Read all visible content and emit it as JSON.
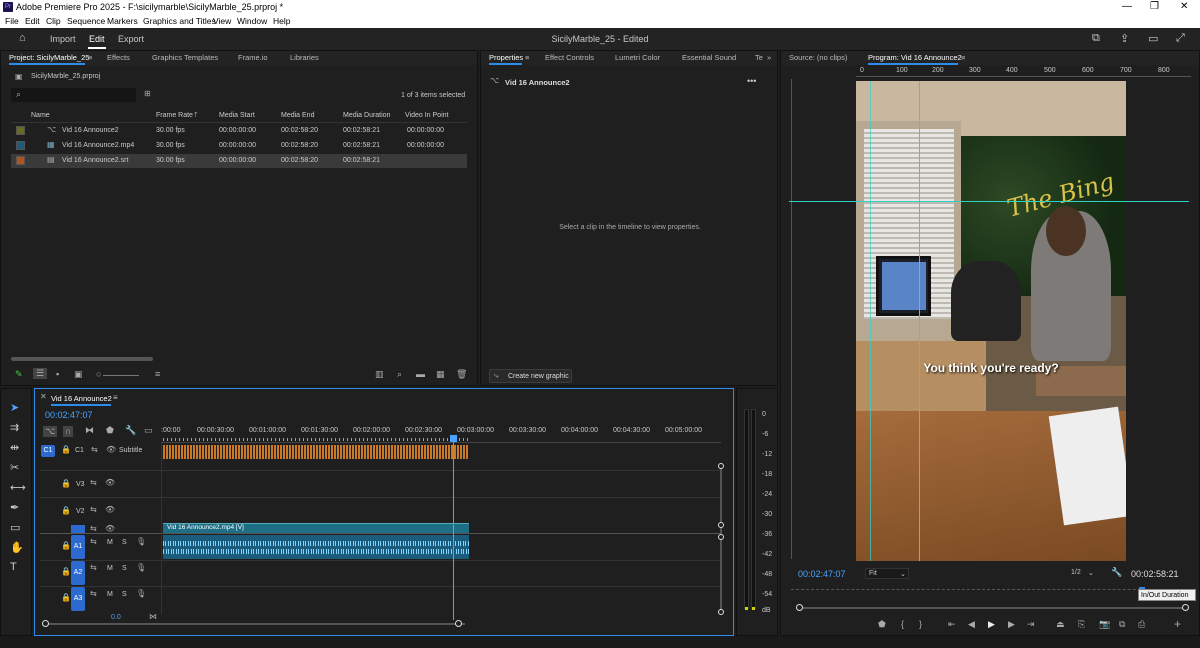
{
  "window": {
    "title": "Adobe Premiere Pro 2025 - F:\\sicilymarble\\SicilyMarble_25.prproj *",
    "logo": "Pr",
    "controls": [
      "—",
      "❐",
      "✕"
    ]
  },
  "menu": [
    "File",
    "Edit",
    "Clip",
    "Sequence",
    "Markers",
    "Graphics and Titles",
    "View",
    "Window",
    "Help"
  ],
  "header": {
    "tabs": [
      "Import",
      "Edit",
      "Export"
    ],
    "active_tab": "Edit",
    "project_title": "SicilyMarble_25 - Edited"
  },
  "project_panel": {
    "tabs": [
      "Project: SicilyMarble_25",
      "Effects",
      "Graphics Templates",
      "Frame.io",
      "Libraries"
    ],
    "file": "SicilyMarble_25.prproj",
    "search_placeholder": "",
    "items_selected": "1 of 3 items selected",
    "columns": [
      "Name",
      "Frame Rate",
      "Media Start",
      "Media End",
      "Media Duration",
      "Video In Point"
    ],
    "rows": [
      {
        "name": "Vid 16 Announce2",
        "frame_rate": "30.00 fps",
        "media_start": "00:00:00:00",
        "media_end": "00:02:58:20",
        "media_duration": "00:02:58:21",
        "video_in": "00:00:00:00",
        "color": "#6b6b1e"
      },
      {
        "name": "Vid 16 Announce2.mp4",
        "frame_rate": "30.00 fps",
        "media_start": "00:00:00:00",
        "media_end": "00:02:58:20",
        "media_duration": "00:02:58:21",
        "video_in": "00:00:00:00",
        "color": "#1e5a7a"
      },
      {
        "name": "Vid 16 Announce2.srt",
        "frame_rate": "30.00 fps",
        "media_start": "00:00:00:00",
        "media_end": "00:02:58:20",
        "media_duration": "00:02:58:21",
        "video_in": "",
        "color": "#b0541e"
      }
    ]
  },
  "properties_panel": {
    "tabs": [
      "Properties",
      "Effect Controls",
      "Lumetri Color",
      "Essential Sound",
      "Te"
    ],
    "item": "Vid 16 Announce2",
    "empty_message": "Select a clip in the timeline to view properties.",
    "create_button": "Create new graphic"
  },
  "program_panel": {
    "tabs": [
      "Source: (no clips)",
      "Program: Vid 16 Announce2"
    ],
    "ruler_labels": [
      "0",
      "100",
      "200",
      "300",
      "400",
      "500",
      "600",
      "700",
      "800"
    ],
    "caption": "You think you're ready?",
    "sign_text": "The Bing",
    "timecode": "00:02:47:07",
    "fit": "Fit",
    "resolution": "1/2",
    "duration": "00:02:58:21",
    "tooltip": "In/Out Duration"
  },
  "timeline": {
    "sequence_name": "Vid 16 Announce2",
    "timecode": "00:02:47:07",
    "ruler": [
      ":00:00",
      "00:00:30:00",
      "00:01:00:00",
      "00:01:30:00",
      "00:02:00:00",
      "00:02:30:00",
      "00:03:00:00",
      "00:03:30:00",
      "00:04:00:00",
      "00:04:30:00",
      "00:05:00:00"
    ],
    "tracks": [
      {
        "id": "C1",
        "label": "C1",
        "name": "Subtitle"
      },
      {
        "id": "V3",
        "label": "V3"
      },
      {
        "id": "V2",
        "label": "V2"
      },
      {
        "id": "V1",
        "label": "V1"
      },
      {
        "id": "A1",
        "label": "A1",
        "m": "M",
        "s": "S"
      },
      {
        "id": "A2",
        "label": "A2",
        "m": "M",
        "s": "S"
      },
      {
        "id": "A3",
        "label": "A3",
        "m": "M",
        "s": "S"
      }
    ],
    "video_clip": "Vid 16 Announce2.mp4 [V]",
    "master_value": "0.0"
  },
  "meter": {
    "labels": [
      "0",
      "-6",
      "-12",
      "-18",
      "-24",
      "-30",
      "-36",
      "-42",
      "-48",
      "-54",
      "dB"
    ]
  },
  "colors": {
    "accent": "#2d8ceb",
    "timecode": "#4aa3ff",
    "subtitle_clip": "#c87a28",
    "video_clip": "#1e6f86",
    "audio_clip": "#1b5c7c",
    "guide": "#2fd3c6"
  }
}
